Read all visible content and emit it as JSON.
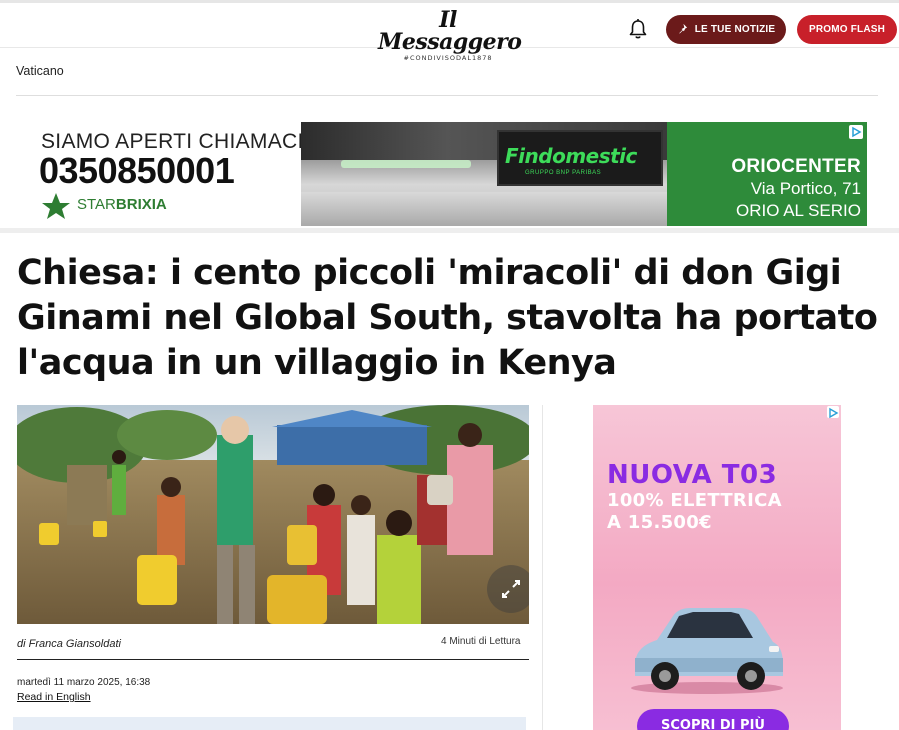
{
  "header": {
    "logo_name": "Il Messaggero",
    "logo_tagline": "#CONDIVISODAL1878",
    "news_button_label": "LE TUE NOTIZIE",
    "flash_button_label": "PROMO FLASH",
    "colors": {
      "news_button": "#6b1a1a",
      "flash_button": "#c8202a"
    }
  },
  "breadcrumb": {
    "section": "Vaticano"
  },
  "top_banner": {
    "headline": "SIAMO APERTI CHIAMACI",
    "phone": "0350850001",
    "brand_prefix": "STAR",
    "brand_suffix": "BRIXIA",
    "store_sign": "Findomestic",
    "store_sign_sub": "GRUPPO BNP PARIBAS",
    "location_name": "ORIOCENTER",
    "address_line1": "Via Portico, 71",
    "address_line2": "ORIO AL SERIO",
    "colors": {
      "green_panel": "#2e8b3a",
      "sign_text": "#3ddc5a"
    }
  },
  "article": {
    "title": "Chiesa: i cento piccoli 'miracoli' di don Gigi Ginami nel Global South, stavolta ha portato l'acqua in un villaggio in Kenya",
    "byline": "di Franca Giansoldati",
    "reading_time": "4 Minuti di Lettura",
    "date": "martedì 11 marzo 2025, 16:38",
    "read_in_english": "Read in English"
  },
  "side_ad": {
    "line1": "NUOVA T03",
    "line2": "100% ELETTRICA",
    "line3": "A 15.500€",
    "cta": "SCOPRI DI PIÙ",
    "colors": {
      "accent": "#8a2be2",
      "background": "#f3a9c3"
    }
  }
}
